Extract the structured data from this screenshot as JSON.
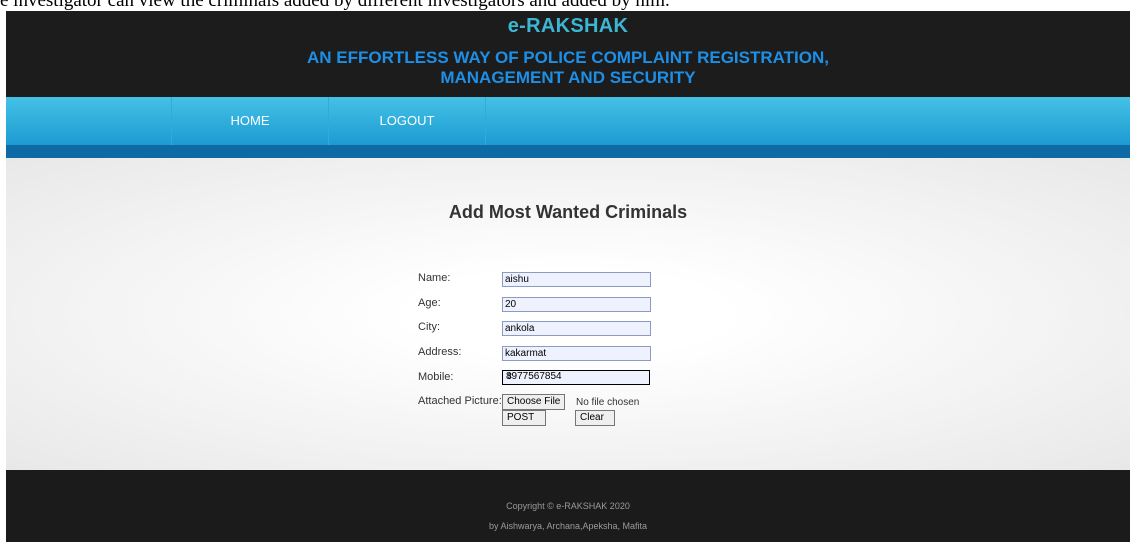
{
  "caption": "e investigator can view the criminals added by different investigators and added by him.",
  "header": {
    "brand": "e-RAKSHAK",
    "tagline_line1": "AN EFFORTLESS WAY OF POLICE COMPLAINT REGISTRATION,",
    "tagline_line2": "MANAGEMENT AND SECURITY"
  },
  "nav": {
    "home": "HOME",
    "logout": "LOGOUT"
  },
  "form": {
    "title": "Add Most Wanted Criminals",
    "name_label": "Name:",
    "name_value": "aishu",
    "age_label": "Age:",
    "age_value": "20",
    "city_label": "City:",
    "city_value": "ankola",
    "address_label": "Address:",
    "address_value": "kakarmat",
    "mobile_label": "Mobile:",
    "mobile_value": "8977567854",
    "picture_label": "Attached Picture:",
    "choose_file": "Choose File",
    "no_file": "No file chosen",
    "post": "POST",
    "clear": "Clear"
  },
  "footer": {
    "copyright": "Copyright © e-RAKSHAK 2020",
    "credits": "by Aishwarya, Archana,Apeksha, Mafita"
  },
  "colors": {
    "brand": "#3cb6d3",
    "tagline": "#1e8fe6",
    "nav": "#1b9bd2",
    "bar": "#0e6aa4"
  }
}
